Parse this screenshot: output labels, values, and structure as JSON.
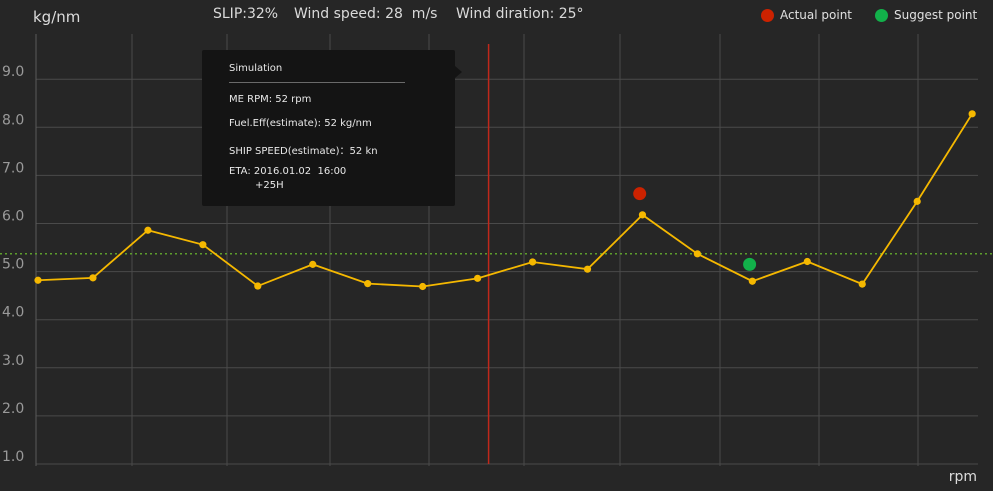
{
  "header": {
    "slip": "SLIP:32%",
    "wind_speed": "Wind speed: 28  m/s",
    "wind_direction": "Wind diration: 25°"
  },
  "legend": {
    "actual": {
      "label": "Actual point",
      "color": "#cc2200"
    },
    "suggest": {
      "label": "Suggest point",
      "color": "#12b04a"
    }
  },
  "tooltip": {
    "title": "Simulation",
    "lines": [
      "ME RPM: 52 rpm",
      "Fuel.Eff(estimate): 52 kg/nm",
      "SHIP SPEED(estimate)：52 kn",
      "ETA: 2016.01.02  16:00",
      "+25H"
    ]
  },
  "colors": {
    "background": "#262626",
    "line": "#f5b800",
    "reference_line": "#5d9e2c",
    "cursor_line": "#c0281b",
    "grid": "#4a4a4a"
  },
  "chart_data": {
    "type": "line",
    "ylabel": "kg/nm",
    "xlabel": "rpm",
    "ylim": [
      1.0,
      9.9
    ],
    "y_ticks": [
      "9.0",
      "8.0",
      "7.0",
      "6.0",
      "5.0",
      "4.0",
      "3.0",
      "2.0",
      "1.0"
    ],
    "grid": true,
    "legend_position": "top-right",
    "series": [
      {
        "values": [
          4.82,
          4.87,
          5.86,
          5.56,
          4.7,
          5.15,
          4.75,
          4.69,
          4.86,
          5.2,
          5.05,
          6.18,
          5.37,
          4.8,
          5.21,
          4.74,
          6.46,
          8.28
        ]
      }
    ],
    "reference_y": 5.37,
    "cursor_index": 8.2,
    "actual_point": {
      "x_index": 10.95,
      "y": 6.62
    },
    "suggest_point": {
      "x_index": 12.95,
      "y": 5.15
    }
  }
}
